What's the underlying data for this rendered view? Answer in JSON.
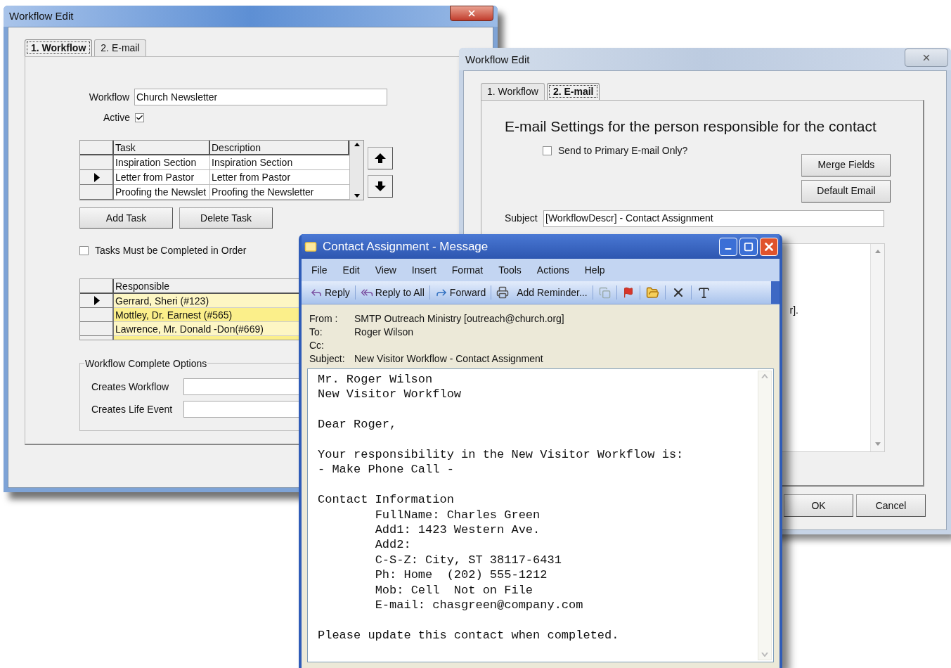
{
  "workflow_window": {
    "title": "Workflow Edit",
    "tabs": [
      {
        "label": "1. Workflow",
        "selected": true
      },
      {
        "label": "2. E-mail",
        "selected": false
      }
    ],
    "workflow_field": {
      "label": "Workflow",
      "value": "Church Newsletter"
    },
    "active": {
      "label": "Active",
      "checked": true
    },
    "task_grid": {
      "columns": [
        "Task",
        "Description"
      ],
      "rows": [
        {
          "task": "Inspiration Section",
          "description": "Inspiration Section",
          "current": false
        },
        {
          "task": "Letter from Pastor",
          "description": "Letter from Pastor",
          "current": true
        },
        {
          "task": "Proofing the Newslet",
          "description": "Proofing the Newsletter",
          "current": false
        }
      ]
    },
    "buttons": [
      "Add Task",
      "Delete Task"
    ],
    "in_order": {
      "label": "Tasks Must be Completed in Order",
      "checked": false
    },
    "responsible_grid": {
      "column": "Responsible",
      "rows": [
        {
          "name": "Gerrard, Sheri (#123)",
          "current": true,
          "highlighted": false
        },
        {
          "name": "Mottley, Dr. Earnest (#565)",
          "current": false,
          "highlighted": true
        },
        {
          "name": "Lawrence, Mr. Donald -Don(#669)",
          "current": false,
          "highlighted": false
        }
      ]
    },
    "complete_options": {
      "title": "Workflow Complete Options",
      "fields": [
        {
          "label": "Creates Workflow"
        },
        {
          "label": "Creates Life Event"
        }
      ]
    }
  },
  "email_window": {
    "title": "Workflow Edit",
    "tabs": [
      {
        "label": "1. Workflow",
        "selected": false
      },
      {
        "label": "2. E-mail",
        "selected": true
      }
    ],
    "heading": "E-mail Settings for the person responsible for the contact",
    "primary_only": {
      "label": "Send to Primary E-mail Only?",
      "checked": false
    },
    "buttons": [
      "Merge Fields",
      "Default Email"
    ],
    "subject": {
      "label": "Subject",
      "value": "[WorkflowDescr] - Contact Assignment"
    },
    "body_fragment": "r].",
    "footer_buttons": [
      "OK",
      "Cancel"
    ]
  },
  "message_window": {
    "title": "Contact Assignment - Message",
    "menu": [
      "File",
      "Edit",
      "View",
      "Insert",
      "Format",
      "Tools",
      "Actions",
      "Help"
    ],
    "toolbar": [
      "Reply",
      "Reply to All",
      "Forward",
      "Add Reminder..."
    ],
    "headers": [
      {
        "label": "From :",
        "value": "SMTP Outreach Ministry [outreach@church.org]"
      },
      {
        "label": "To:",
        "value": "Roger Wilson"
      },
      {
        "label": "Cc:"
      },
      {
        "label": "Subject:",
        "value": "New Visitor Workflow - Contact Assignment"
      }
    ],
    "body": [
      [
        "Mr. Roger Wilson",
        "New Visitor Workflow"
      ],
      [
        "Dear Roger,"
      ],
      [
        "Your responsibility in the New Visitor Workflow is:",
        "- Make Phone Call -"
      ],
      [
        "Contact Information",
        "\tFullName: Charles Green",
        "\tAdd1: 1423 Western Ave.",
        "\tAdd2:",
        "\tC-S-Z: City, ST 38117-6431",
        "\tPh: Home  (202) 555-1212",
        "\tMob: Cell  Not on File",
        "\tE-mail: chasgreen@company.com"
      ],
      [
        "Please update this contact when completed."
      ]
    ]
  }
}
